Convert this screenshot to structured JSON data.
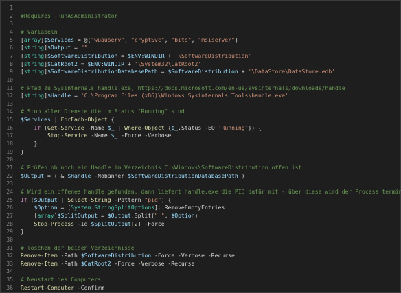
{
  "editor": {
    "lines": [
      {
        "n": "1",
        "tokens": []
      },
      {
        "n": "2",
        "tokens": [
          {
            "c": "c",
            "t": "#Requires -RunAsAdministrator"
          }
        ]
      },
      {
        "n": "3",
        "tokens": []
      },
      {
        "n": "4",
        "tokens": [
          {
            "c": "c",
            "t": "# Variabeln"
          }
        ]
      },
      {
        "n": "5",
        "tokens": [
          {
            "c": "p",
            "t": "["
          },
          {
            "c": "t",
            "t": "array"
          },
          {
            "c": "p",
            "t": "]"
          },
          {
            "c": "v",
            "t": "$Services"
          },
          {
            "c": "p",
            "t": " = @("
          },
          {
            "c": "s",
            "t": "\"wuauserv\""
          },
          {
            "c": "p",
            "t": ", "
          },
          {
            "c": "s",
            "t": "\"cryptSvc\""
          },
          {
            "c": "p",
            "t": ", "
          },
          {
            "c": "s",
            "t": "\"bits\""
          },
          {
            "c": "p",
            "t": ", "
          },
          {
            "c": "s",
            "t": "\"msiserver\""
          },
          {
            "c": "p",
            "t": ")"
          }
        ]
      },
      {
        "n": "6",
        "tokens": [
          {
            "c": "p",
            "t": "["
          },
          {
            "c": "t",
            "t": "string"
          },
          {
            "c": "p",
            "t": "]"
          },
          {
            "c": "v",
            "t": "$Output"
          },
          {
            "c": "p",
            "t": " = "
          },
          {
            "c": "s",
            "t": "\"\""
          }
        ]
      },
      {
        "n": "7",
        "tokens": [
          {
            "c": "p",
            "t": "["
          },
          {
            "c": "t",
            "t": "string"
          },
          {
            "c": "p",
            "t": "]"
          },
          {
            "c": "v",
            "t": "$SoftwareDistribution"
          },
          {
            "c": "p",
            "t": " = "
          },
          {
            "c": "v",
            "t": "$ENV:WINDIR"
          },
          {
            "c": "p",
            "t": " + "
          },
          {
            "c": "s",
            "t": "'\\SoftwareDistribution'"
          }
        ]
      },
      {
        "n": "8",
        "tokens": [
          {
            "c": "p",
            "t": "["
          },
          {
            "c": "t",
            "t": "string"
          },
          {
            "c": "p",
            "t": "]"
          },
          {
            "c": "v",
            "t": "$CatRoot2"
          },
          {
            "c": "p",
            "t": " = "
          },
          {
            "c": "v",
            "t": "$ENV:WINDIR"
          },
          {
            "c": "p",
            "t": " + "
          },
          {
            "c": "s",
            "t": "'\\System32\\CatRoot2'"
          }
        ]
      },
      {
        "n": "9",
        "tokens": [
          {
            "c": "p",
            "t": "["
          },
          {
            "c": "t",
            "t": "string"
          },
          {
            "c": "p",
            "t": "]"
          },
          {
            "c": "v",
            "t": "$SoftwareDistributionDatabasePath"
          },
          {
            "c": "p",
            "t": " = "
          },
          {
            "c": "v",
            "t": "$SoftwareDistribution"
          },
          {
            "c": "p",
            "t": " + "
          },
          {
            "c": "s",
            "t": "'\\DataStore\\DataStore.edb'"
          }
        ]
      },
      {
        "n": "10",
        "tokens": []
      },
      {
        "n": "11",
        "tokens": [
          {
            "c": "c",
            "t": "# Pfad zu Sysinternals handle.exe, "
          },
          {
            "c": "u",
            "t": "https://docs.microsoft.com/en-us/sysinternals/downloads/handle"
          }
        ]
      },
      {
        "n": "12",
        "tokens": [
          {
            "c": "p",
            "t": "["
          },
          {
            "c": "t",
            "t": "string"
          },
          {
            "c": "p",
            "t": "]"
          },
          {
            "c": "v",
            "t": "$Handle"
          },
          {
            "c": "p",
            "t": " = "
          },
          {
            "c": "s",
            "t": "'C:\\Program Files (x86)\\Windows Sysinternals Tools\\handle.exe'"
          }
        ]
      },
      {
        "n": "13",
        "tokens": []
      },
      {
        "n": "14",
        "tokens": [
          {
            "c": "c",
            "t": "# Stop aller Dienste die im Status \"Running\" sind"
          }
        ]
      },
      {
        "n": "15",
        "tokens": [
          {
            "c": "v",
            "t": "$Services"
          },
          {
            "c": "p",
            "t": " | "
          },
          {
            "c": "f",
            "t": "ForEach-Object"
          },
          {
            "c": "p",
            "t": " {"
          }
        ]
      },
      {
        "n": "16",
        "tokens": [
          {
            "c": "p",
            "t": "    "
          },
          {
            "c": "k",
            "t": "If"
          },
          {
            "c": "p",
            "t": " ("
          },
          {
            "c": "f",
            "t": "Get-Service"
          },
          {
            "c": "p",
            "t": " -Name "
          },
          {
            "c": "v",
            "t": "$_"
          },
          {
            "c": "p",
            "t": " | "
          },
          {
            "c": "f",
            "t": "Where-Object"
          },
          {
            "c": "p",
            "t": " {"
          },
          {
            "c": "v",
            "t": "$_"
          },
          {
            "c": "p",
            "t": ".Status -EQ "
          },
          {
            "c": "s",
            "t": "'Running'"
          },
          {
            "c": "p",
            "t": "}) {"
          }
        ]
      },
      {
        "n": "17",
        "tokens": [
          {
            "c": "p",
            "t": "        "
          },
          {
            "c": "f",
            "t": "Stop-Service"
          },
          {
            "c": "p",
            "t": " -Name "
          },
          {
            "c": "v",
            "t": "$_"
          },
          {
            "c": "p",
            "t": " -Force -Verbose"
          }
        ]
      },
      {
        "n": "18",
        "tokens": [
          {
            "c": "p",
            "t": "    }"
          }
        ]
      },
      {
        "n": "19",
        "tokens": [
          {
            "c": "p",
            "t": "}"
          }
        ]
      },
      {
        "n": "20",
        "tokens": []
      },
      {
        "n": "21",
        "tokens": [
          {
            "c": "c",
            "t": "# Prüfen ob noch ein Handle im Verzeichnis C:\\Windows\\SoftwareDistribution offen ist"
          }
        ]
      },
      {
        "n": "22",
        "tokens": [
          {
            "c": "v",
            "t": "$Output"
          },
          {
            "c": "p",
            "t": " = ( & "
          },
          {
            "c": "v",
            "t": "$Handle"
          },
          {
            "c": "p",
            "t": " -Nobanner "
          },
          {
            "c": "v",
            "t": "$SoftwareDistributionDatabasePath"
          },
          {
            "c": "p",
            "t": " )"
          }
        ]
      },
      {
        "n": "23",
        "tokens": []
      },
      {
        "n": "24",
        "tokens": [
          {
            "c": "c",
            "t": "# Wird ein offenes handle gefunden, dann liefert handle.exe die PID dafür mit - über diese wird der Process terminiert"
          }
        ]
      },
      {
        "n": "25",
        "tokens": [
          {
            "c": "k",
            "t": "If"
          },
          {
            "c": "p",
            "t": " ("
          },
          {
            "c": "v",
            "t": "$Output"
          },
          {
            "c": "p",
            "t": " | "
          },
          {
            "c": "f",
            "t": "Select-String"
          },
          {
            "c": "p",
            "t": " -Pattern "
          },
          {
            "c": "s",
            "t": "\"pid\""
          },
          {
            "c": "p",
            "t": ") {"
          }
        ]
      },
      {
        "n": "26",
        "tokens": [
          {
            "c": "p",
            "t": "    "
          },
          {
            "c": "v",
            "t": "$Option"
          },
          {
            "c": "p",
            "t": " = ["
          },
          {
            "c": "t",
            "t": "System.StringSplitOptions"
          },
          {
            "c": "p",
            "t": "]::RemoveEmptyEntries"
          }
        ]
      },
      {
        "n": "27",
        "tokens": [
          {
            "c": "p",
            "t": "    ["
          },
          {
            "c": "t",
            "t": "array"
          },
          {
            "c": "p",
            "t": "]"
          },
          {
            "c": "v",
            "t": "$SplitOutput"
          },
          {
            "c": "p",
            "t": " = "
          },
          {
            "c": "v",
            "t": "$Output"
          },
          {
            "c": "p",
            "t": ".Split("
          },
          {
            "c": "s",
            "t": "\" \""
          },
          {
            "c": "p",
            "t": ", "
          },
          {
            "c": "v",
            "t": "$Option"
          },
          {
            "c": "p",
            "t": ")"
          }
        ]
      },
      {
        "n": "28",
        "tokens": [
          {
            "c": "p",
            "t": "    "
          },
          {
            "c": "f",
            "t": "Stop-Process"
          },
          {
            "c": "p",
            "t": " -Id "
          },
          {
            "c": "v",
            "t": "$SplitOutput"
          },
          {
            "c": "p",
            "t": "["
          },
          {
            "c": "n",
            "t": "2"
          },
          {
            "c": "p",
            "t": "] -Force"
          }
        ]
      },
      {
        "n": "29",
        "tokens": [
          {
            "c": "p",
            "t": "}"
          }
        ]
      },
      {
        "n": "30",
        "tokens": []
      },
      {
        "n": "31",
        "tokens": [
          {
            "c": "c",
            "t": "# löschen der beiden Verzeichnisse"
          }
        ]
      },
      {
        "n": "32",
        "tokens": [
          {
            "c": "f",
            "t": "Remove-Item"
          },
          {
            "c": "p",
            "t": " -Path "
          },
          {
            "c": "v",
            "t": "$SoftwareDistribution"
          },
          {
            "c": "p",
            "t": " -Force -Verbose -Recurse"
          }
        ]
      },
      {
        "n": "33",
        "tokens": [
          {
            "c": "f",
            "t": "Remove-Item"
          },
          {
            "c": "p",
            "t": " -Path "
          },
          {
            "c": "v",
            "t": "$CatRoot2"
          },
          {
            "c": "p",
            "t": " -Force -Verbose -Recurse"
          }
        ]
      },
      {
        "n": "34",
        "tokens": []
      },
      {
        "n": "35",
        "tokens": [
          {
            "c": "c",
            "t": "# Neustart des Computers"
          }
        ]
      },
      {
        "n": "36",
        "tokens": [
          {
            "c": "f",
            "t": "Restart-Computer"
          },
          {
            "c": "p",
            "t": " -Confirm"
          }
        ]
      }
    ]
  }
}
